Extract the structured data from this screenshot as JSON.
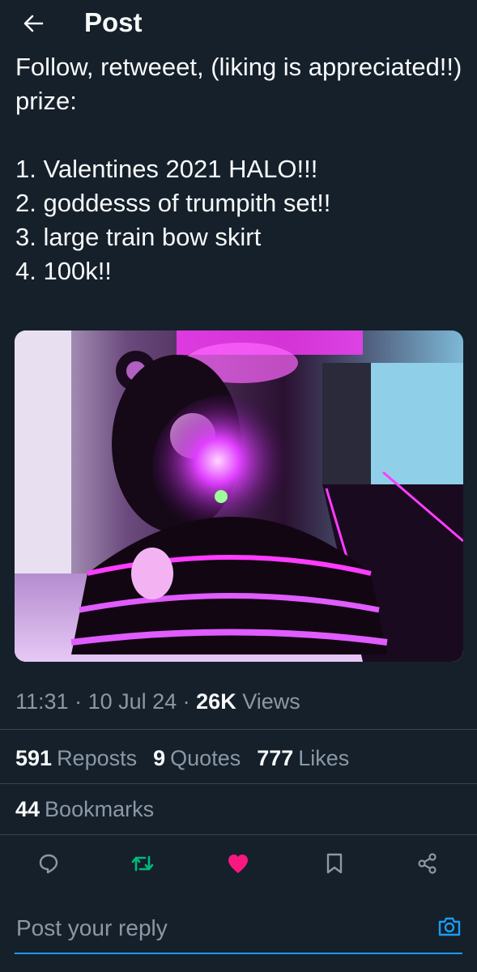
{
  "header": {
    "title": "Post"
  },
  "tweet": {
    "text": "Follow, retweeet, (liking is appreciated!!) prize:\n\n1. Valentines 2021 HALO!!!\n2. goddesss of trumpith set!!\n3. large train bow skirt\n4. 100k!!"
  },
  "meta": {
    "time": "11:31",
    "sep1": " · ",
    "date": "10 Jul 24",
    "sep2": " · ",
    "views_count": "26K",
    "views_label": "Views"
  },
  "stats": {
    "reposts_count": "591",
    "reposts_label": "Reposts",
    "quotes_count": "9",
    "quotes_label": "Quotes",
    "likes_count": "777",
    "likes_label": "Likes",
    "bookmarks_count": "44",
    "bookmarks_label": "Bookmarks"
  },
  "reply": {
    "placeholder": "Post your reply"
  },
  "colors": {
    "background": "#15202b",
    "accent": "#1d9bf0",
    "repost_active": "#00ba7c",
    "like_active": "#f91880",
    "muted": "#8b98a5"
  },
  "icons": [
    "back-arrow-icon",
    "reply-icon",
    "repost-icon",
    "like-icon",
    "bookmark-icon",
    "share-icon",
    "camera-icon"
  ]
}
